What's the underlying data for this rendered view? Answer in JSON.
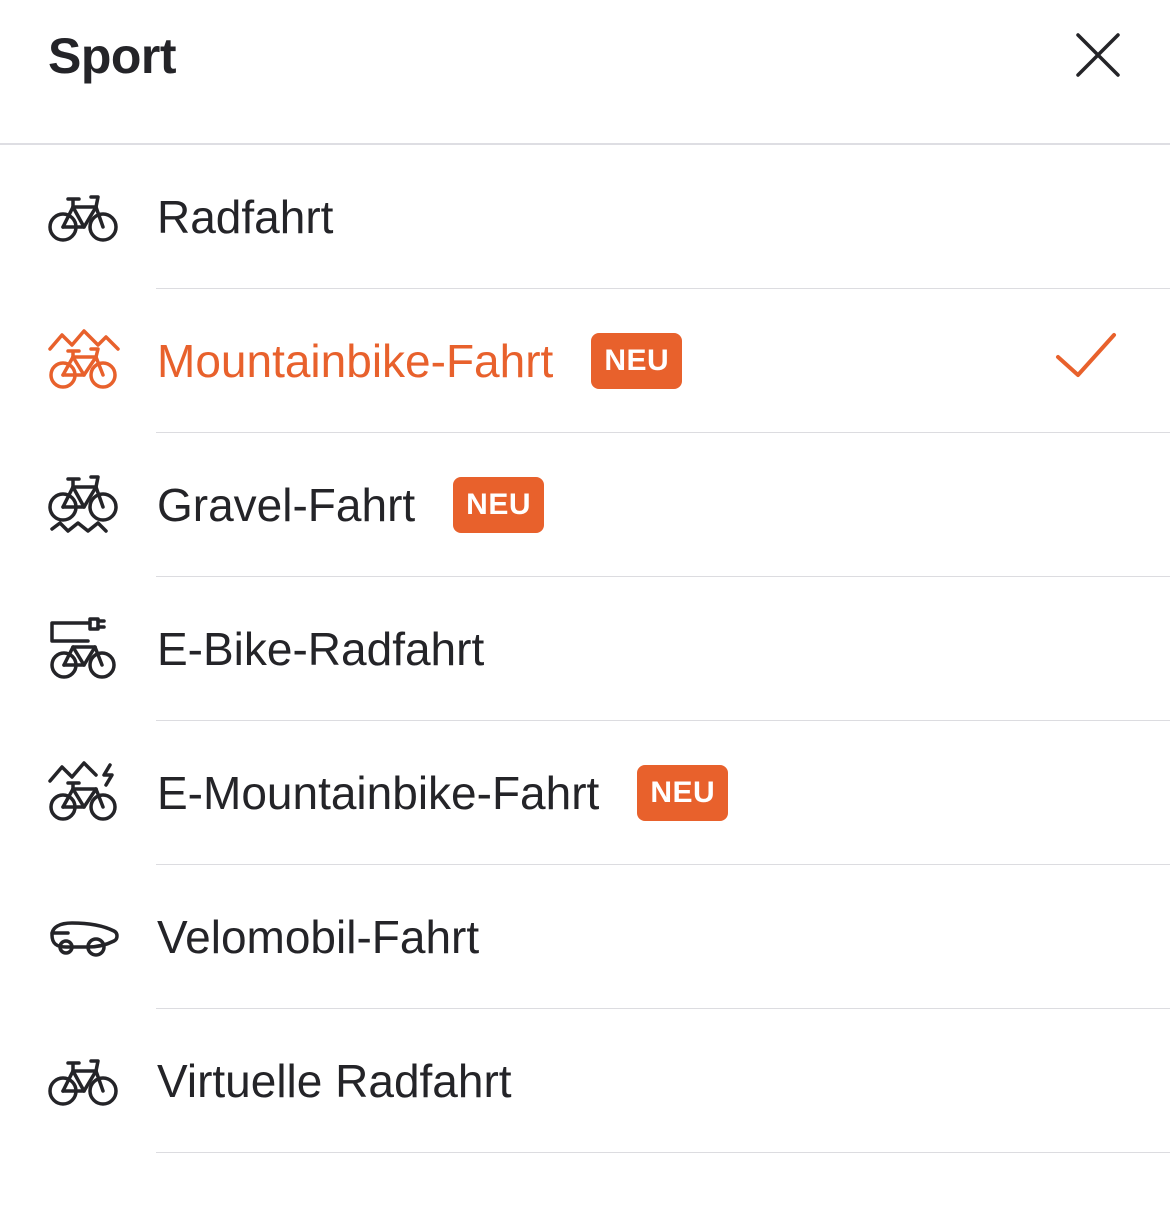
{
  "header": {
    "title": "Sport",
    "close_icon": "close-icon"
  },
  "colors": {
    "accent": "#e8612c",
    "text": "#242428",
    "divider": "#dcdce0"
  },
  "items": [
    {
      "label": "Radfahrt",
      "icon": "bike-icon",
      "badge": "",
      "selected": false
    },
    {
      "label": "Mountainbike-Fahrt",
      "icon": "mountain-bike-icon",
      "badge": "NEU",
      "selected": true
    },
    {
      "label": "Gravel-Fahrt",
      "icon": "gravel-bike-icon",
      "badge": "NEU",
      "selected": false
    },
    {
      "label": "E-Bike-Radfahrt",
      "icon": "e-bike-icon",
      "badge": "",
      "selected": false
    },
    {
      "label": "E-Mountainbike-Fahrt",
      "icon": "e-mountain-bike-icon",
      "badge": "NEU",
      "selected": false
    },
    {
      "label": "Velomobil-Fahrt",
      "icon": "velomobile-icon",
      "badge": "",
      "selected": false
    },
    {
      "label": "Virtuelle Radfahrt",
      "icon": "virtual-bike-icon",
      "badge": "",
      "selected": false
    }
  ],
  "selected_icon": "checkmark-icon"
}
